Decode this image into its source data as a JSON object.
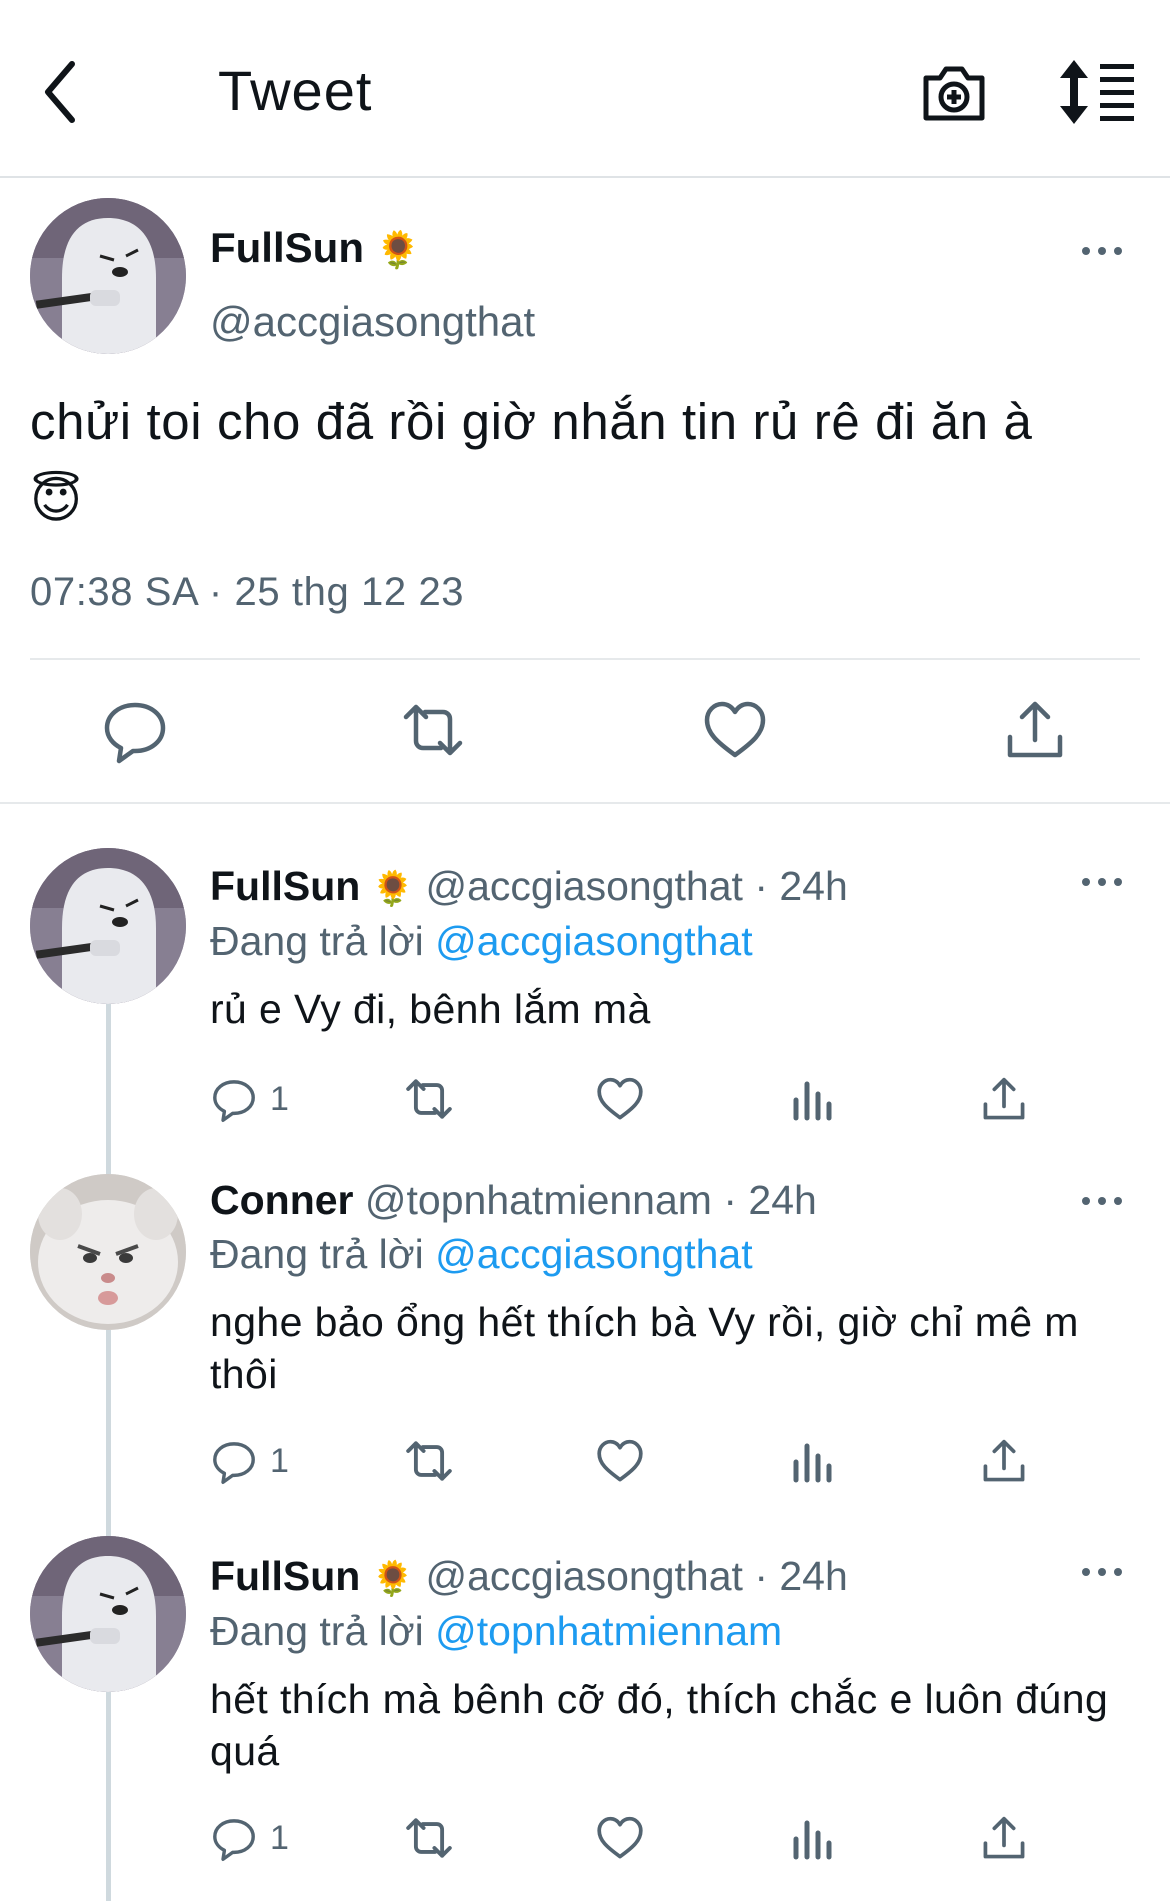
{
  "header": {
    "title": "Tweet"
  },
  "main_tweet": {
    "author_name": "FullSun",
    "author_badge": "🌻",
    "author_handle": "@accgiasongthat",
    "text": "chửi toi cho đã rồi giờ nhắn tin rủ rê đi ăn à",
    "emoji": "😇",
    "timestamp": "07:38 SA · 25 thg 12 23"
  },
  "replies": [
    {
      "author_name": "FullSun",
      "author_badge": "🌻",
      "author_handle": "@accgiasongthat",
      "time": "· 24h",
      "replying_label": "Đang trả lời",
      "replying_to": "@accgiasongthat",
      "text": "rủ e Vy đi, bênh lắm mà",
      "reply_count": "1"
    },
    {
      "author_name": "Conner",
      "author_badge": "",
      "author_handle": "@topnhatmiennam",
      "time": "· 24h",
      "replying_label": "Đang trả lời",
      "replying_to": "@accgiasongthat",
      "text": "nghe bảo ổng hết thích bà Vy rồi, giờ chỉ mê m thôi",
      "reply_count": "1"
    },
    {
      "author_name": "FullSun",
      "author_badge": "🌻",
      "author_handle": "@accgiasongthat",
      "time": "· 24h",
      "replying_label": "Đang trả lời",
      "replying_to": "@topnhatmiennam",
      "text": "hết thích mà bênh cỡ đó, thích chắc e luôn đúng quá",
      "reply_count": "1"
    }
  ],
  "colors": {
    "link": "#1d9bf0",
    "secondary_text": "#536471",
    "icon": "#536471"
  }
}
